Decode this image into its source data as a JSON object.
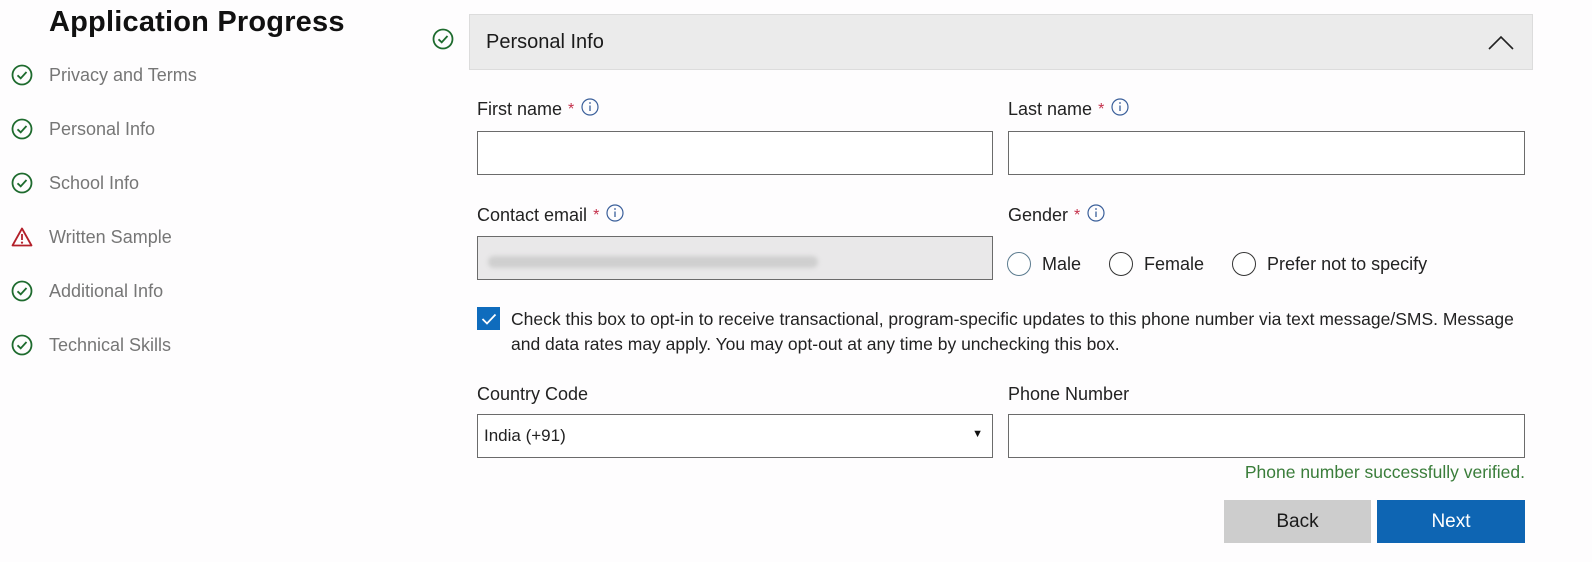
{
  "sidebar": {
    "title": "Application Progress",
    "steps": [
      {
        "label": "Privacy and Terms",
        "status": "complete",
        "icon": "check-circle-icon"
      },
      {
        "label": "Personal Info",
        "status": "complete",
        "icon": "check-circle-icon"
      },
      {
        "label": "School Info",
        "status": "complete",
        "icon": "check-circle-icon"
      },
      {
        "label": "Written Sample",
        "status": "warning",
        "icon": "warning-triangle-icon"
      },
      {
        "label": "Additional Info",
        "status": "complete",
        "icon": "check-circle-icon"
      },
      {
        "label": "Technical Skills",
        "status": "complete",
        "icon": "check-circle-icon"
      }
    ]
  },
  "section": {
    "title": "Personal Info",
    "status": "complete",
    "expanded": true,
    "collapse_icon": "chevron-up-icon"
  },
  "form": {
    "first_name": {
      "label": "First name",
      "required_mark": "*",
      "value": ""
    },
    "last_name": {
      "label": "Last name",
      "required_mark": "*",
      "value": ""
    },
    "contact_email": {
      "label": "Contact email",
      "required_mark": "*",
      "value": "",
      "disabled": true,
      "redacted": true
    },
    "gender": {
      "label": "Gender",
      "required_mark": "*",
      "options": [
        "Male",
        "Female",
        "Prefer not to specify"
      ],
      "selected": null
    },
    "sms_opt_in": {
      "checked": true,
      "text": "Check this box to opt-in to receive transactional, program-specific updates to this phone number via text message/SMS. Message and data rates may apply. You may opt-out at any time by unchecking this box."
    },
    "country_code": {
      "label": "Country Code",
      "value": "India (+91)"
    },
    "phone_number": {
      "label": "Phone Number",
      "value": ""
    },
    "verification_message": "Phone number successfully verified."
  },
  "buttons": {
    "back": "Back",
    "next": "Next"
  },
  "colors": {
    "success": "#1e6b2e",
    "warning": "#b3202a",
    "primary": "#0e65b3",
    "required": "#c4314b",
    "verified_text": "#3a7d3a"
  }
}
